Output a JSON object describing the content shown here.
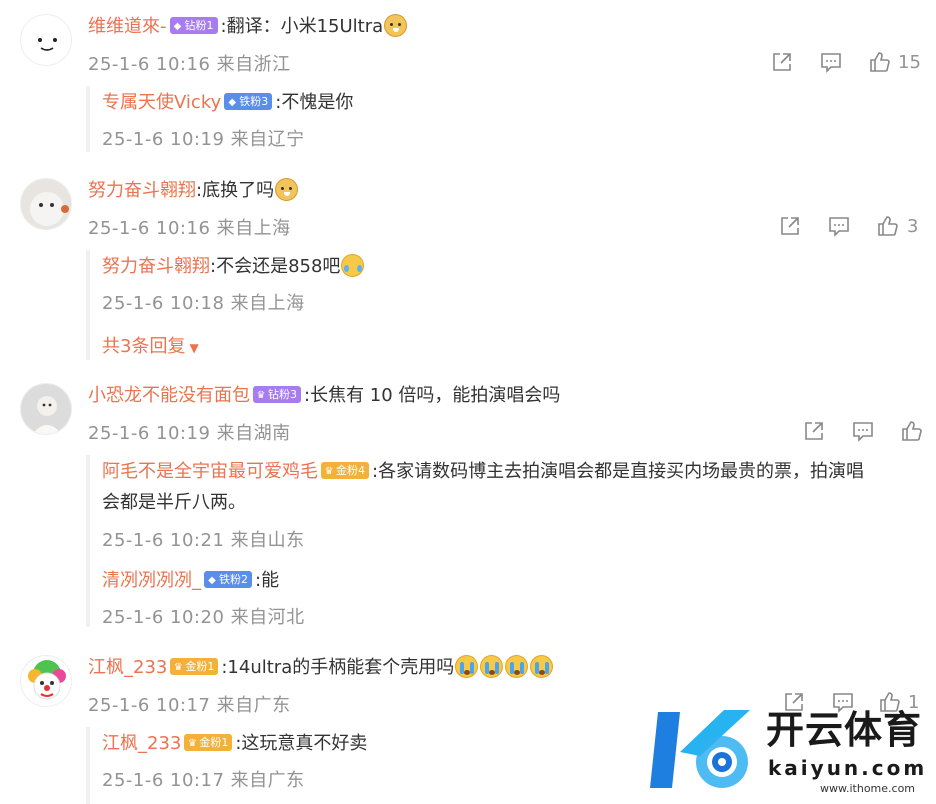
{
  "comments": [
    {
      "name": "维维道來-",
      "badge": "钻粉1",
      "text": ":翻译：小米15Ultra",
      "emoji": "doge",
      "time": "25-1-6 10:16",
      "location": "来自浙江",
      "likes": "15",
      "replies": [
        {
          "name": "专属天使Vicky",
          "badge": "铁粉3",
          "text": ":不愧是你",
          "time": "25-1-6 10:19",
          "location": "来自辽宁"
        }
      ]
    },
    {
      "name": "努力奋斗翱翔",
      "text": ":底换了吗",
      "emoji": "doge",
      "time": "25-1-6 10:16",
      "location": "来自上海",
      "likes": "3",
      "replies": [
        {
          "name": "努力奋斗翱翔",
          "text": ":不会还是858吧",
          "emoji": "laugh",
          "time": "25-1-6 10:18",
          "location": "来自上海"
        }
      ],
      "more_replies": "共3条回复"
    },
    {
      "name": "小恐龙不能没有面包",
      "badge": "钻粉3",
      "text": ":长焦有 10 倍吗，能拍演唱会吗",
      "time": "25-1-6 10:19",
      "location": "来自湖南",
      "likes": "",
      "replies": [
        {
          "name": "阿毛不是全宇宙最可爱鸡毛",
          "badge": "金粉4",
          "text": ":各家请数码博主去拍演唱会都是直接买内场最贵的票，拍演唱",
          "text2": "会都是半斤八两。",
          "time": "25-1-6 10:21",
          "location": "来自山东"
        },
        {
          "name": "清冽冽冽冽_",
          "badge": "铁粉2",
          "text": ":能",
          "time": "25-1-6 10:20",
          "location": "来自河北"
        }
      ]
    },
    {
      "name": "江枫_233",
      "badge": "金粉1",
      "text": ":14ultra的手柄能套个壳用吗",
      "emoji": "cry",
      "time": "25-1-6 10:17",
      "location": "来自广东",
      "likes": "1",
      "replies": [
        {
          "name": "江枫_233",
          "badge": "金粉1",
          "text": ":这玩意真不好卖",
          "time": "25-1-6 10:17",
          "location": "来自广东"
        }
      ]
    }
  ],
  "watermark": {
    "brand": "开云体育",
    "domain": "kaiyun.com",
    "small": "www.ithome.com"
  },
  "colors": {
    "name": "#eb7350",
    "meta": "#939393",
    "text": "#333333"
  },
  "icons": [
    "share-icon",
    "comment-icon",
    "like-icon",
    "chevron-down-icon"
  ]
}
